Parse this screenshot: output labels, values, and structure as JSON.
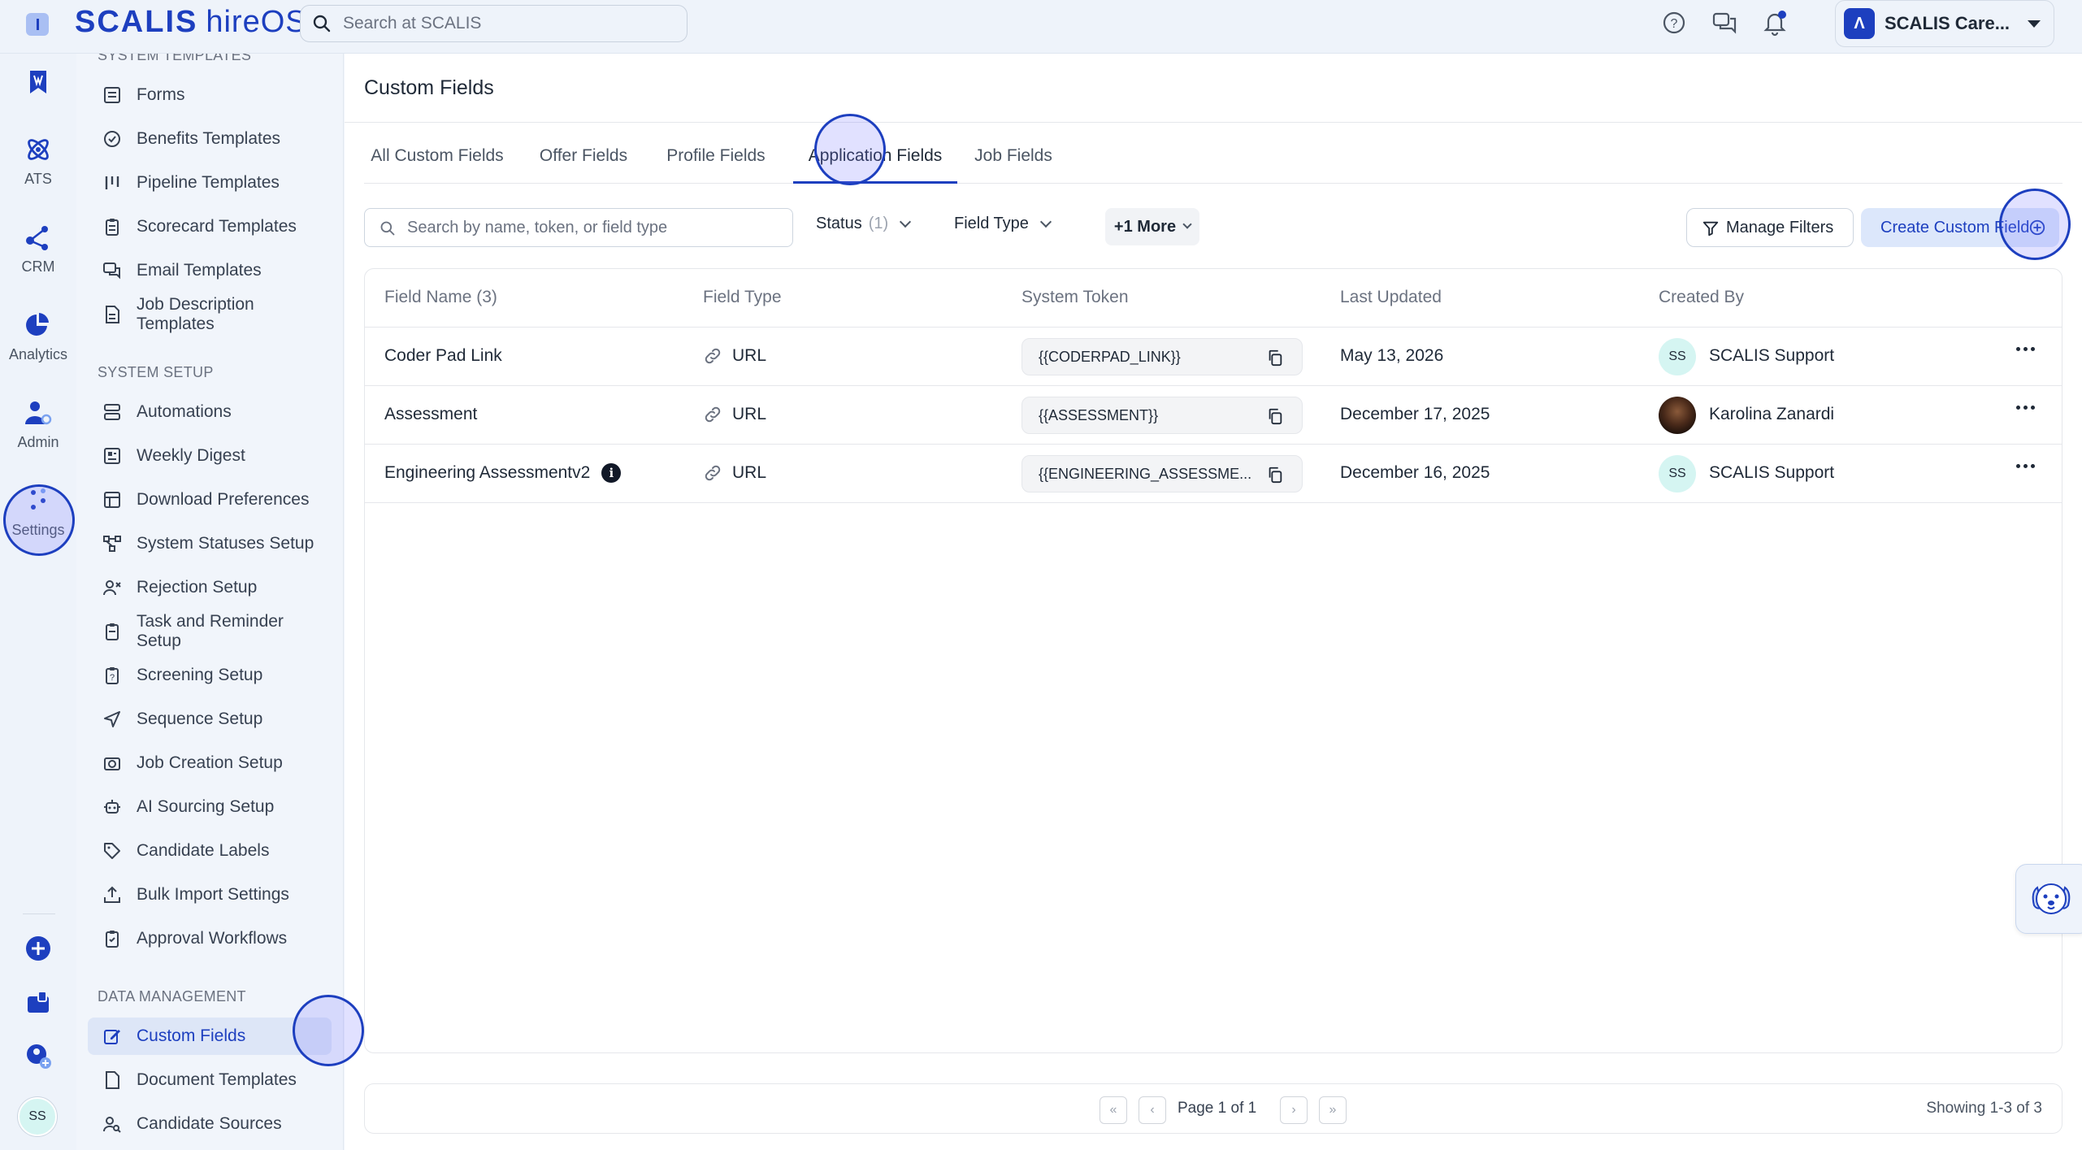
{
  "topbar": {
    "brand": "SCALIS",
    "product": "hireOS",
    "search_placeholder": "Search at SCALIS",
    "org_initial": "Λ",
    "org_name": "SCALIS Care..."
  },
  "rail": {
    "items": [
      {
        "label": ""
      },
      {
        "label": "ATS"
      },
      {
        "label": "CRM"
      },
      {
        "label": "Analytics"
      },
      {
        "label": "Admin"
      },
      {
        "label": "Settings"
      }
    ],
    "avatar_initials": "SS"
  },
  "nav": {
    "section_templates": "SYSTEM TEMPLATES",
    "templates": [
      "Forms",
      "Benefits Templates",
      "Pipeline Templates",
      "Scorecard Templates",
      "Email Templates",
      "Job Description Templates"
    ],
    "section_setup": "SYSTEM SETUP",
    "setup": [
      "Automations",
      "Weekly Digest",
      "Download Preferences",
      "System Statuses Setup",
      "Rejection Setup",
      "Task and Reminder Setup",
      "Screening Setup",
      "Sequence Setup",
      "Job Creation Setup",
      "AI Sourcing Setup",
      "Candidate Labels",
      "Bulk Import Settings",
      "Approval Workflows"
    ],
    "section_data": "DATA MANAGEMENT",
    "data": [
      "Custom Fields",
      "Document Templates",
      "Candidate Sources"
    ]
  },
  "main": {
    "title": "Custom Fields",
    "tabs": [
      "All Custom Fields",
      "Offer Fields",
      "Profile Fields",
      "Application Fields",
      "Job Fields"
    ],
    "active_tab": "Application Fields",
    "search_placeholder": "Search by name, token, or field type",
    "filters": {
      "status_label": "Status",
      "status_count": "(1)",
      "field_type_label": "Field Type",
      "more_label": "+1 More",
      "manage_label": "Manage Filters",
      "create_label": "Create Custom Field"
    },
    "columns": [
      "Field Name (3)",
      "Field Type",
      "System Token",
      "Last Updated",
      "Created By"
    ],
    "rows": [
      {
        "name": "Coder Pad Link",
        "type": "URL",
        "token": "{{CODERPAD_LINK}}",
        "updated": "May 13, 2026",
        "creator": "SCALIS Support",
        "initials": "SS"
      },
      {
        "name": "Assessment",
        "type": "URL",
        "token": "{{ASSESSMENT}}",
        "updated": "December 17, 2025",
        "creator": "Karolina Zanardi",
        "initials": ""
      },
      {
        "name": "Engineering Assessmentv2",
        "type": "URL",
        "token": "{{ENGINEERING_ASSESSME...",
        "updated": "December 16, 2025",
        "creator": "SCALIS Support",
        "initials": "SS"
      }
    ],
    "pager": {
      "page_text": "Page 1 of 1",
      "showing": "Showing 1-3 of 3"
    }
  },
  "colors": {
    "accent": "#1d3fbf",
    "background": "#f1f5fb",
    "active_nav_bg": "#dde6f7"
  }
}
